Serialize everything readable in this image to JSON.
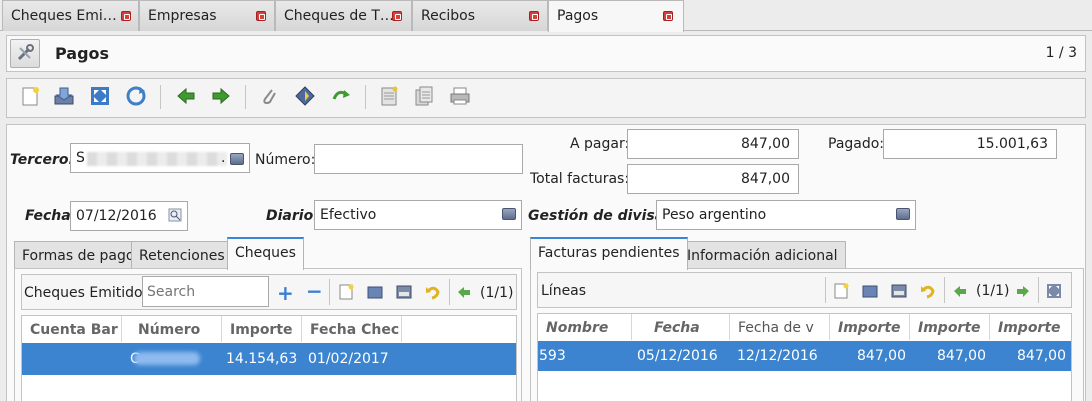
{
  "tabs": [
    {
      "label": "Cheques Emi…"
    },
    {
      "label": "Empresas"
    },
    {
      "label": "Cheques de T…"
    },
    {
      "label": "Recibos"
    },
    {
      "label": "Pagos"
    }
  ],
  "window": {
    "title": "Pagos",
    "record_counter": "1 / 3"
  },
  "toolbar": {
    "icons": [
      "new-record-icon",
      "save-icon",
      "fullscreen-icon",
      "refresh-icon",
      "previous-record-icon",
      "next-record-icon",
      "attachment-icon",
      "action-icon",
      "relate-icon",
      "print-icon",
      "print-preview-icon",
      "printer-icon"
    ]
  },
  "form": {
    "tercero": {
      "label": "Tercero:",
      "value": "S",
      "value_end": "."
    },
    "numero": {
      "label": "Número:",
      "value": ""
    },
    "a_pagar": {
      "label": "A pagar:",
      "value": "847,00"
    },
    "pagado": {
      "label": "Pagado:",
      "value": "15.001,63"
    },
    "total_facturas": {
      "label": "Total facturas:",
      "value": "847,00"
    },
    "fecha": {
      "label": "Fecha:",
      "value": "07/12/2016"
    },
    "diario": {
      "label": "Diario:",
      "value": "Efectivo"
    },
    "gestion_divisas": {
      "label": "Gestión de divisas:",
      "value": "Peso argentino"
    }
  },
  "left_tabs": [
    {
      "label": "Formas de pago"
    },
    {
      "label": "Retenciones"
    },
    {
      "label": "Cheques"
    }
  ],
  "cheques": {
    "title": "Cheques Emitidos",
    "search_placeholder": "Search",
    "pager": "(1/1)",
    "columns": [
      "Cuenta Bar",
      "Número",
      "Importe",
      "Fecha Chec"
    ],
    "rows": [
      {
        "cuenta": "",
        "numero": "C",
        "importe": "14.154,63",
        "fecha": "01/02/2017"
      }
    ]
  },
  "right_tabs": [
    {
      "label": "Facturas pendientes"
    },
    {
      "label": "Información adicional"
    }
  ],
  "facturas": {
    "title": "Líneas",
    "pager": "(1/1)",
    "columns": [
      "Nombre",
      "Fecha",
      "Fecha de v",
      "Importe",
      "Importe",
      "Importe"
    ],
    "rows": [
      {
        "nombre": "593",
        "fecha": "05/12/2016",
        "vencimiento": "12/12/2016",
        "importe1": "847,00",
        "importe2": "847,00",
        "importe3": "847,00"
      }
    ]
  },
  "colors": {
    "selection": "#3c84cf",
    "accent": "#3a86d4"
  }
}
